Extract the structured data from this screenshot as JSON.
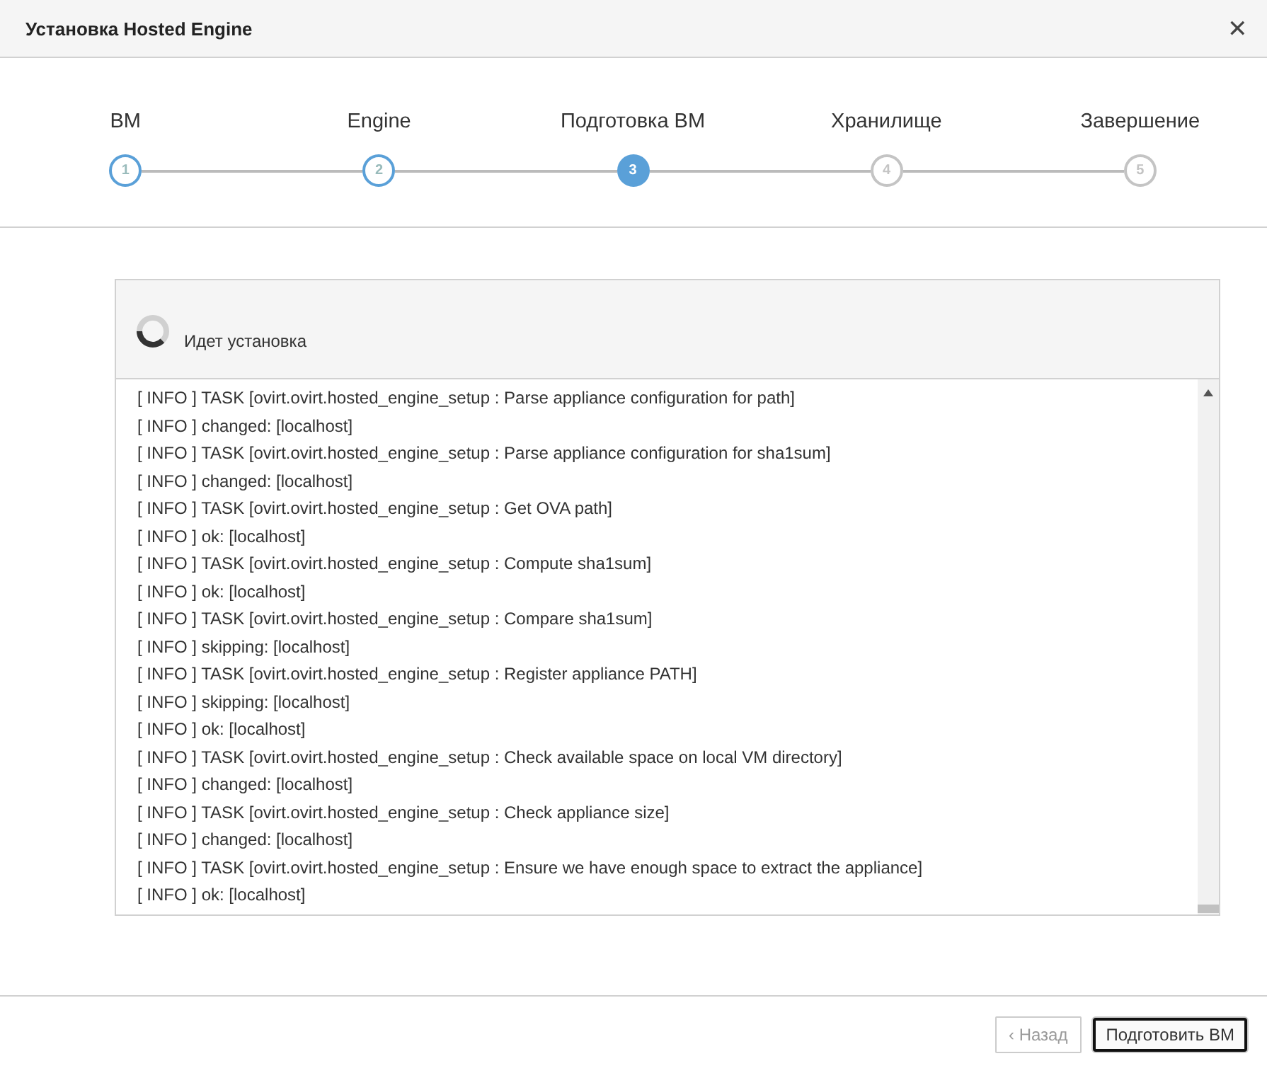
{
  "window": {
    "title": "Установка Hosted Engine",
    "close": "✕"
  },
  "steps": [
    {
      "number": "1",
      "label": "ВМ",
      "completed": true,
      "selected": false
    },
    {
      "number": "2",
      "label": "Engine",
      "completed": true,
      "selected": false
    },
    {
      "number": "3",
      "label": "Подготовка ВМ",
      "completed": false,
      "selected": true
    },
    {
      "number": "4",
      "label": "Хранилище",
      "completed": false,
      "selected": false
    },
    {
      "number": "5",
      "label": "Завершение",
      "completed": false,
      "selected": false
    }
  ],
  "progress": {
    "status": "Идет установка"
  },
  "log": [
    "[ INFO ] TASK [ovirt.ovirt.hosted_engine_setup : Parse appliance configuration for path]",
    "[ INFO ] changed: [localhost]",
    "[ INFO ] TASK [ovirt.ovirt.hosted_engine_setup : Parse appliance configuration for sha1sum]",
    "[ INFO ] changed: [localhost]",
    "[ INFO ] TASK [ovirt.ovirt.hosted_engine_setup : Get OVA path]",
    "[ INFO ] ok: [localhost]",
    "[ INFO ] TASK [ovirt.ovirt.hosted_engine_setup : Compute sha1sum]",
    "[ INFO ] ok: [localhost]",
    "[ INFO ] TASK [ovirt.ovirt.hosted_engine_setup : Compare sha1sum]",
    "[ INFO ] skipping: [localhost]",
    "[ INFO ] TASK [ovirt.ovirt.hosted_engine_setup : Register appliance PATH]",
    "[ INFO ] skipping: [localhost]",
    "[ INFO ] ok: [localhost]",
    "[ INFO ] TASK [ovirt.ovirt.hosted_engine_setup : Check available space on local VM directory]",
    "[ INFO ] changed: [localhost]",
    "[ INFO ] TASK [ovirt.ovirt.hosted_engine_setup : Check appliance size]",
    "[ INFO ] changed: [localhost]",
    "[ INFO ] TASK [ovirt.ovirt.hosted_engine_setup : Ensure we have enough space to extract the appliance]",
    "[ INFO ] ok: [localhost]"
  ],
  "buttons": [
    {
      "label": "‹ Назад",
      "disabled": true,
      "focused": false
    },
    {
      "label": "Подготовить ВМ",
      "disabled": false,
      "focused": true
    }
  ]
}
